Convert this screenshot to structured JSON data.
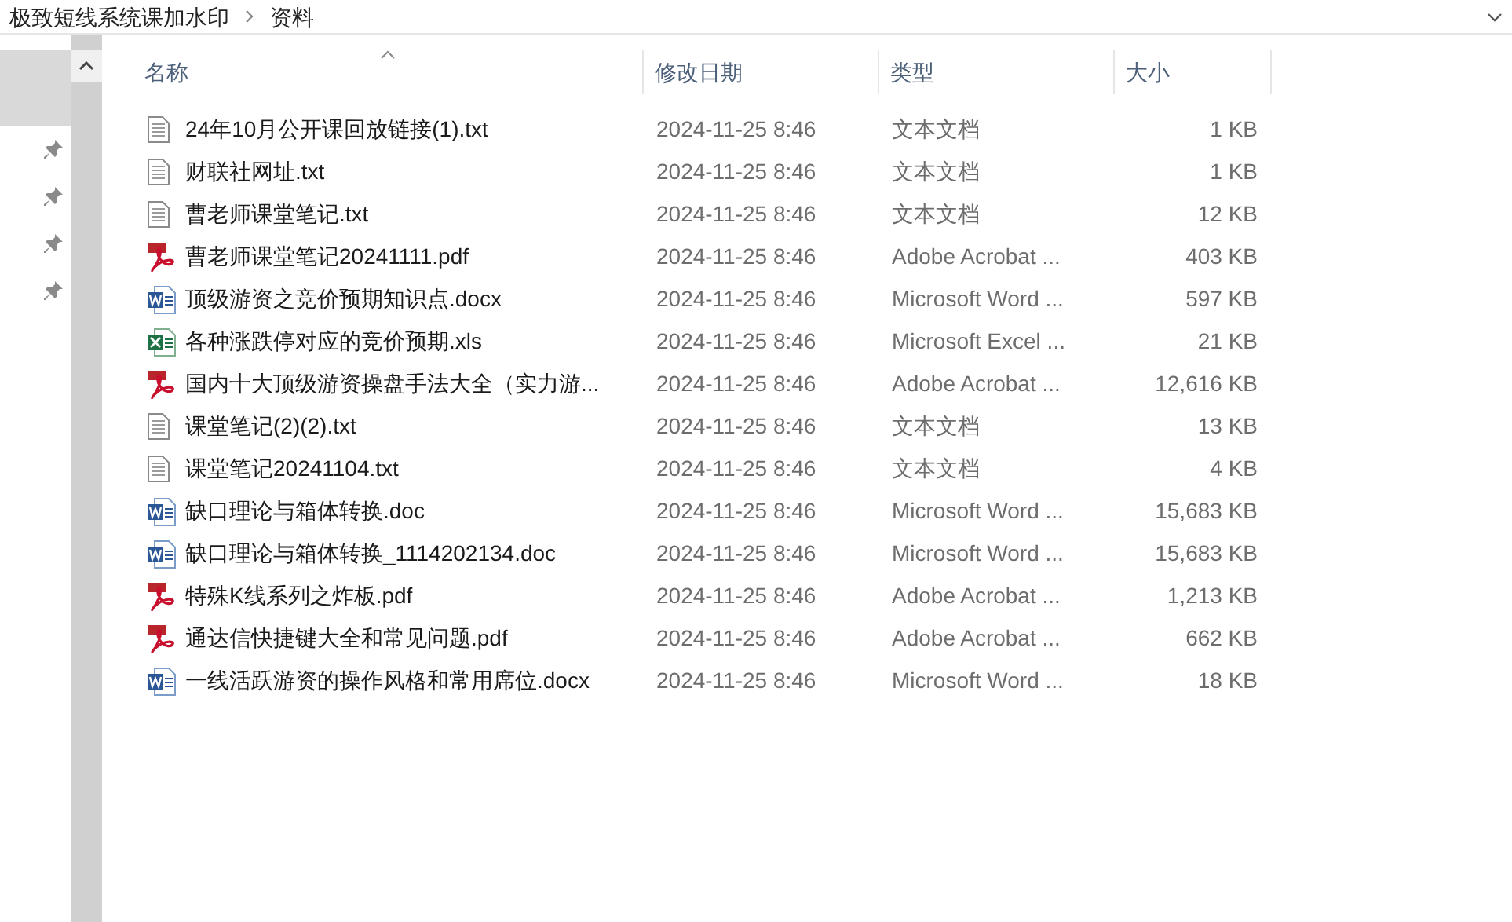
{
  "breadcrumb": [
    {
      "label": "极致短线系统课加水印"
    },
    {
      "label": "资料"
    }
  ],
  "nav": {
    "items": [
      {
        "selected": true,
        "pinned": false
      },
      {
        "selected": false,
        "pinned": true
      },
      {
        "selected": false,
        "pinned": true
      },
      {
        "selected": false,
        "pinned": true
      },
      {
        "selected": false,
        "pinned": true
      }
    ]
  },
  "table": {
    "columns": [
      "名称",
      "修改日期",
      "类型",
      "大小"
    ],
    "rows": [
      {
        "kind": "txt",
        "name": "24年10月公开课回放链接(1).txt",
        "date": "2024-11-25 8:46",
        "type": "文本文档",
        "size": "1 KB"
      },
      {
        "kind": "txt",
        "name": "财联社网址.txt",
        "date": "2024-11-25 8:46",
        "type": "文本文档",
        "size": "1 KB"
      },
      {
        "kind": "txt",
        "name": "曹老师课堂笔记.txt",
        "date": "2024-11-25 8:46",
        "type": "文本文档",
        "size": "12 KB"
      },
      {
        "kind": "pdf",
        "name": "曹老师课堂笔记20241111.pdf",
        "date": "2024-11-25 8:46",
        "type": "Adobe Acrobat ...",
        "size": "403 KB"
      },
      {
        "kind": "word",
        "name": "顶级游资之竞价预期知识点.docx",
        "date": "2024-11-25 8:46",
        "type": "Microsoft Word ...",
        "size": "597 KB"
      },
      {
        "kind": "excel",
        "name": "各种涨跌停对应的竞价预期.xls",
        "date": "2024-11-25 8:46",
        "type": "Microsoft Excel ...",
        "size": "21 KB"
      },
      {
        "kind": "pdf",
        "name": "国内十大顶级游资操盘手法大全（实力游...",
        "date": "2024-11-25 8:46",
        "type": "Adobe Acrobat ...",
        "size": "12,616 KB"
      },
      {
        "kind": "txt",
        "name": "课堂笔记(2)(2).txt",
        "date": "2024-11-25 8:46",
        "type": "文本文档",
        "size": "13 KB"
      },
      {
        "kind": "txt",
        "name": "课堂笔记20241104.txt",
        "date": "2024-11-25 8:46",
        "type": "文本文档",
        "size": "4 KB"
      },
      {
        "kind": "word",
        "name": "缺口理论与箱体转换.doc",
        "date": "2024-11-25 8:46",
        "type": "Microsoft Word ...",
        "size": "15,683 KB"
      },
      {
        "kind": "word",
        "name": "缺口理论与箱体转换_1114202134.doc",
        "date": "2024-11-25 8:46",
        "type": "Microsoft Word ...",
        "size": "15,683 KB"
      },
      {
        "kind": "pdf",
        "name": "特殊K线系列之炸板.pdf",
        "date": "2024-11-25 8:46",
        "type": "Adobe Acrobat ...",
        "size": "1,213 KB"
      },
      {
        "kind": "pdf",
        "name": "通达信快捷键大全和常见问题.pdf",
        "date": "2024-11-25 8:46",
        "type": "Adobe Acrobat ...",
        "size": "662 KB"
      },
      {
        "kind": "word",
        "name": "一线活跃游资的操作风格和常用席位.docx",
        "date": "2024-11-25 8:46",
        "type": "Microsoft Word ...",
        "size": "18 KB"
      }
    ]
  }
}
